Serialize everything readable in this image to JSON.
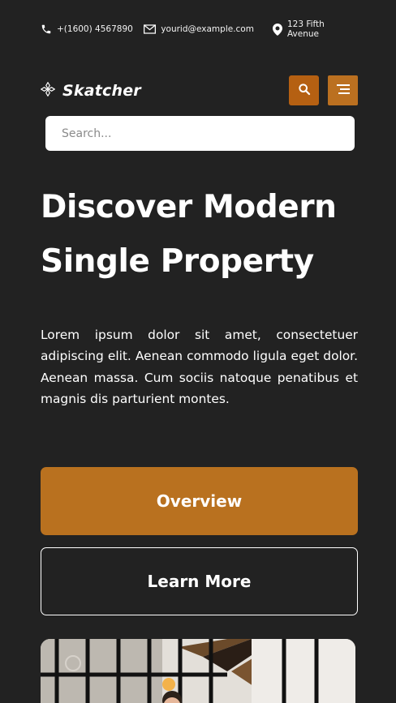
{
  "contact": {
    "phone": "+(1600) 4567890",
    "email": "yourid@example.com",
    "address": "123 Fifth Avenue"
  },
  "header": {
    "brand": "Skatcher"
  },
  "search": {
    "placeholder": "Search..."
  },
  "hero": {
    "title_line1": "Discover Modern",
    "title_line2": "Single Property",
    "description": "Lorem ipsum dolor sit amet, consectetuer adipiscing elit. Aenean commodo ligula eget dolor. Aenean massa. Cum sociis natoque penatibus et magnis dis parturient montes.",
    "primary_button": "Overview",
    "secondary_button": "Learn More"
  },
  "colors": {
    "background": "#222222",
    "accent": "#b9711f",
    "search_button": "#b56012"
  },
  "icons": [
    "phone-icon",
    "envelope-icon",
    "map-pin-icon",
    "logo-icon",
    "search-icon",
    "menu-icon"
  ]
}
